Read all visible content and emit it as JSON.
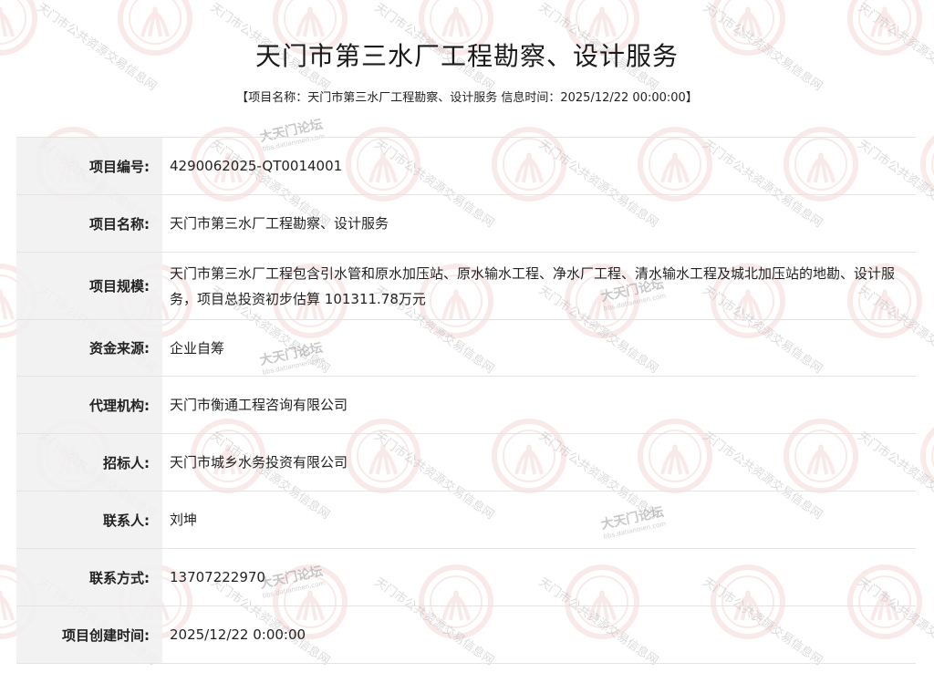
{
  "page": {
    "title": "天门市第三水厂工程勘察、设计服务",
    "subtitle": {
      "open_bracket": "【",
      "name_label": "项目名称：",
      "name_value": "天门市第三水厂工程勘察、设计服务",
      "time_label": " 信息时间：",
      "time_value": "2025/12/22 00:00:00",
      "close_bracket": "】"
    }
  },
  "details": [
    {
      "label": "项目编号:",
      "value": "4290062025-QT0014001"
    },
    {
      "label": "项目名称:",
      "value": "天门市第三水厂工程勘察、设计服务"
    },
    {
      "label": "项目规模:",
      "value": "天门市第三水厂工程包含引水管和原水加压站、原水输水工程、净水厂工程、清水输水工程及城北加压站的地勘、设计服务，项目总投资初步估算 101311.78万元"
    },
    {
      "label": "资金来源:",
      "value": "企业自筹"
    },
    {
      "label": "代理机构:",
      "value": "天门市衡通工程咨询有限公司"
    },
    {
      "label": "招标人:",
      "value": "天门市城乡水务投资有限公司"
    },
    {
      "label": "联系人:",
      "value": "刘坤"
    },
    {
      "label": "联系方式:",
      "value": "13707222970"
    },
    {
      "label": "项目创建时间:",
      "value": "2025/12/22 0:00:00"
    }
  ],
  "watermark": {
    "text_main": "天门市公共资源交易信息网",
    "forum_text": "大天门论坛",
    "forum_url": "bbs.datianmen.com",
    "color": "#e8a0a0"
  }
}
